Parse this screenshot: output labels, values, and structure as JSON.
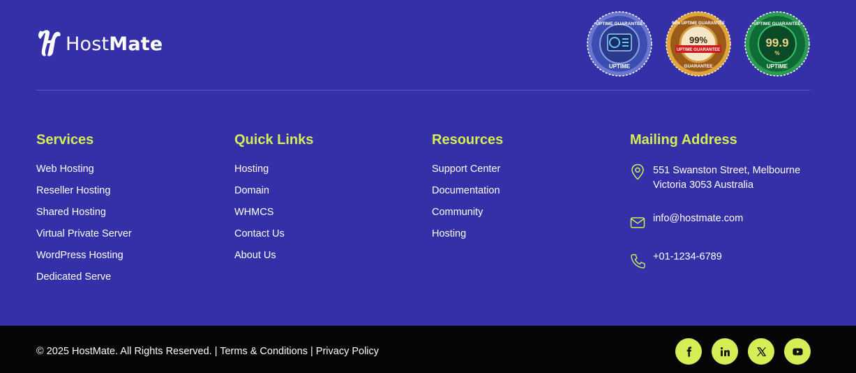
{
  "brand": {
    "name_part1": "Host",
    "name_part2": "Mate"
  },
  "badges": [
    {
      "icon": "uptime-guarantee-blue-badge",
      "top_text": "UPTIME GUARANTEE",
      "bottom_text": "UPTIME"
    },
    {
      "icon": "uptime-guarantee-gold-badge",
      "top_text": "99% UPTIME GUARANTEE",
      "value": "99%",
      "ribbon": "UPTIME GUARANTEE",
      "bottom_text": "GUARANTEE"
    },
    {
      "icon": "uptime-guarantee-green-badge",
      "top_text": "UPTIME GUARANTEE",
      "value": "99.9",
      "unit": "%",
      "bottom_text": "UPTIME"
    }
  ],
  "services": {
    "title": "Services",
    "items": [
      "Web Hosting",
      "Reseller Hosting",
      "Shared Hosting",
      "Virtual Private Server",
      "WordPress Hosting",
      "Dedicated Serve"
    ]
  },
  "quick_links": {
    "title": "Quick Links",
    "items": [
      "Hosting",
      "Domain",
      "WHMCS",
      "Contact Us",
      "About Us"
    ]
  },
  "resources": {
    "title": "Resources",
    "items": [
      "Support Center",
      "Documentation",
      "Community",
      "Hosting"
    ]
  },
  "mailing": {
    "title": "Mailing Address",
    "address_line1": "551 Swanston Street, Melbourne",
    "address_line2": "Victoria 3053 Australia",
    "email": "info@hostmate.com",
    "phone": "+01-1234-6789",
    "icons": [
      "location-pin-icon",
      "mail-icon",
      "phone-icon"
    ]
  },
  "bottom": {
    "copyright": "© 2025 HostMate. All Rights Reserved.",
    "sep1": " | ",
    "terms": "Terms & Conditions",
    "sep2": " | ",
    "privacy": "Privacy Policy"
  },
  "socials": [
    "facebook-icon",
    "linkedin-icon",
    "x-twitter-icon",
    "youtube-icon"
  ],
  "colors": {
    "background": "#3630a8",
    "accent": "#d3ef55",
    "bottom_bar": "#050505"
  }
}
